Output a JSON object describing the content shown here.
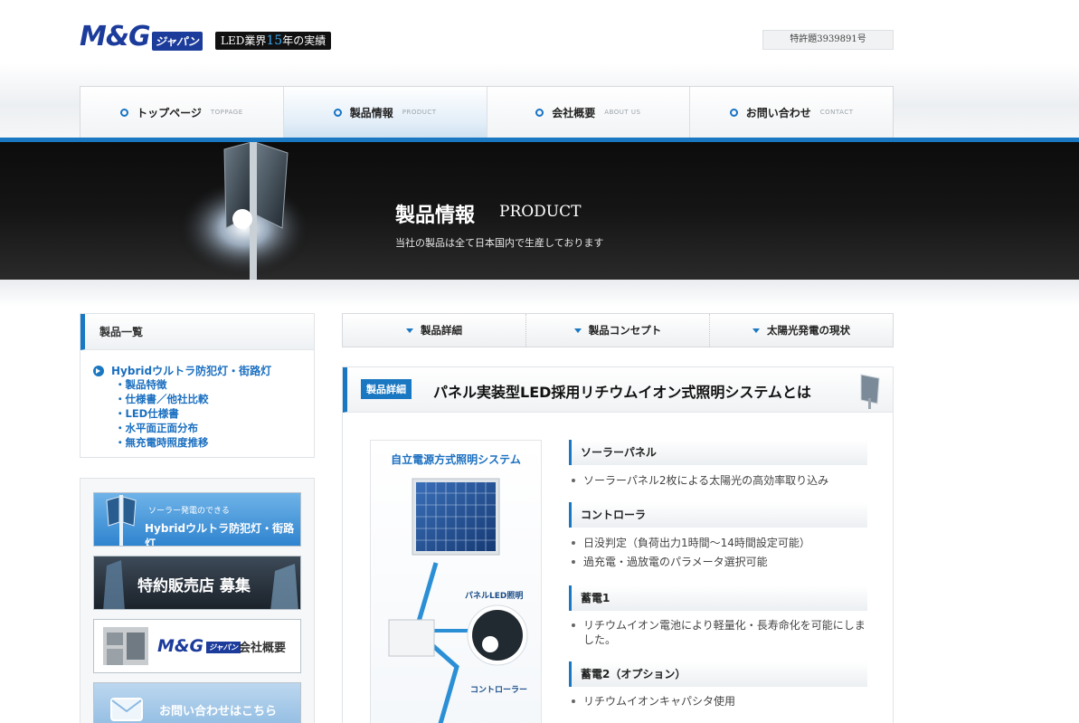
{
  "header": {
    "logo_mg": "M&G",
    "logo_jp": "ジャパン",
    "tag_prefix": "LED業界",
    "tag_number": "15",
    "tag_suffix": "年の実績",
    "patent": "特許題3939891号"
  },
  "nav": {
    "items": [
      {
        "label": "トップページ",
        "en": "TOPPAGE"
      },
      {
        "label": "製品情報",
        "en": "PRODUCT"
      },
      {
        "label": "会社概要",
        "en": "ABOUT US"
      },
      {
        "label": "お問い合わせ",
        "en": "CONTACT"
      }
    ],
    "active_index": 1
  },
  "hero": {
    "title": "製品情報",
    "title_en": "PRODUCT",
    "subtitle": "当社の製品は全て日本国内で生産しております"
  },
  "sidebar": {
    "heading": "製品一覧",
    "main_item": "Hybridウルトラ防犯灯・街路灯",
    "sub_items": [
      "・製品特徴",
      "・仕様書／他社比較",
      "・LED仕様書",
      "・水平面正面分布",
      "・無充電時照度推移"
    ],
    "banners": {
      "b1_small": "ソーラー発電のできる",
      "b1_big": "Hybridウルトラ防犯灯・街路灯",
      "b2": "特約販売店 募集",
      "b3_logo": "M&G",
      "b3_jp": "ジャパン",
      "b3_text": "会社概要",
      "b4": "お問い合わせはこちら"
    }
  },
  "subnav": [
    "製品詳細",
    "製品コンセプト",
    "太陽光発電の現状"
  ],
  "content": {
    "badge": "製品詳細",
    "title": "パネル実装型LED採用リチウムイオン式照明システムとは",
    "diagram": {
      "title": "自立電源方式照明システム",
      "label_led": "パネルLED照明",
      "label_controller": "コントローラー"
    },
    "spec": [
      {
        "heading": "ソーラーパネル",
        "items": [
          "ソーラーパネル2枚による太陽光の高効率取り込み"
        ]
      },
      {
        "heading": "コントローラ",
        "items": [
          "日没判定（負荷出力1時間〜14時間設定可能）",
          "過充電・過放電のパラメータ選択可能"
        ]
      },
      {
        "heading": "蓄電1",
        "items": [
          "リチウムイオン電池により軽量化・長寿命化を可能にしました。"
        ]
      },
      {
        "heading": "蓄電2（オプション）",
        "items": [
          "リチウムイオンキャパシタ使用"
        ]
      }
    ]
  }
}
